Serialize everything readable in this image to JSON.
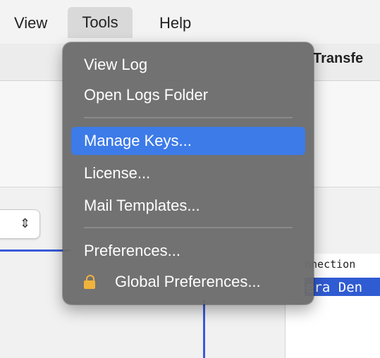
{
  "menubar": {
    "items": [
      "View",
      "Tools",
      "Help"
    ]
  },
  "background": {
    "transfer_tab": "Transfe",
    "column_header": "nnection",
    "selected_cell": "era Den",
    "stepper_glyph": "⇕"
  },
  "tools_menu": {
    "items": [
      {
        "label": "View Log"
      },
      {
        "label": "Open Logs Folder"
      },
      {
        "label": "Manage Keys..."
      },
      {
        "label": "License..."
      },
      {
        "label": "Mail Templates..."
      },
      {
        "label": "Preferences..."
      },
      {
        "label": "Global Preferences..."
      }
    ],
    "highlighted": "Manage Keys...",
    "highlight_color": "#3d7be8",
    "lock_icon_color": "#f2b33d"
  }
}
